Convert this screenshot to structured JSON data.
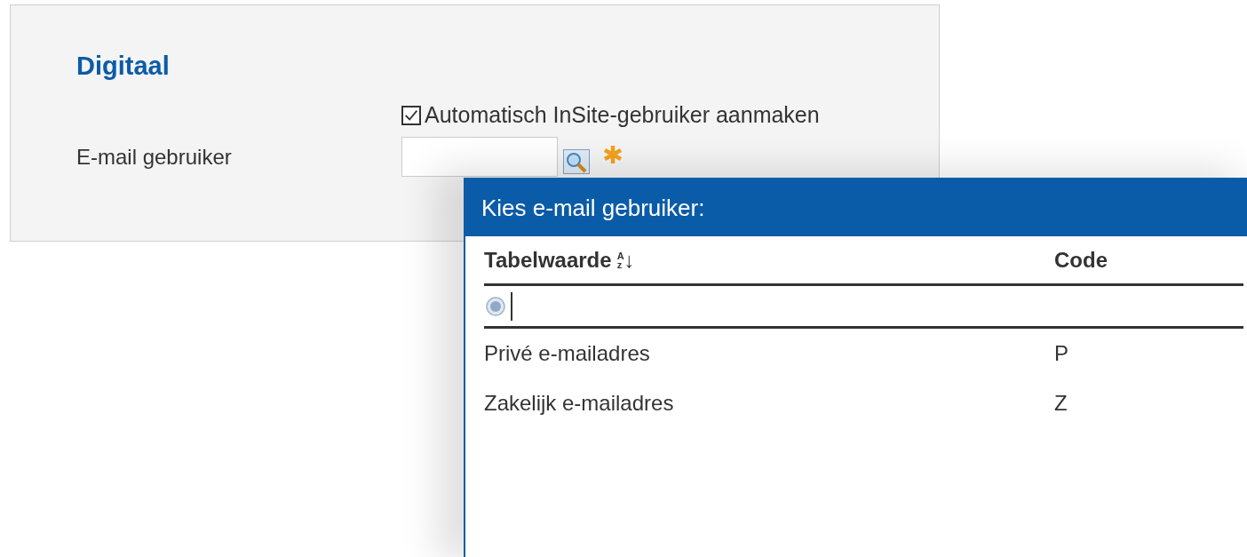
{
  "panel": {
    "title": "Digitaal",
    "checkbox": {
      "label": "Automatisch InSite-gebruiker aanmaken",
      "checked": true
    },
    "email_field": {
      "label": "E-mail gebruiker"
    }
  },
  "popup": {
    "title": "Kies e-mail gebruiker:",
    "columns": [
      {
        "label": "Tabelwaarde",
        "sort": {
          "top": "A",
          "bottom": "z",
          "arrow": "↓"
        }
      },
      {
        "label": "Code"
      }
    ],
    "rows": [
      {
        "value": "Privé e-mailadres",
        "code": "P"
      },
      {
        "value": "Zakelijk e-mailadres",
        "code": "Z"
      }
    ]
  }
}
